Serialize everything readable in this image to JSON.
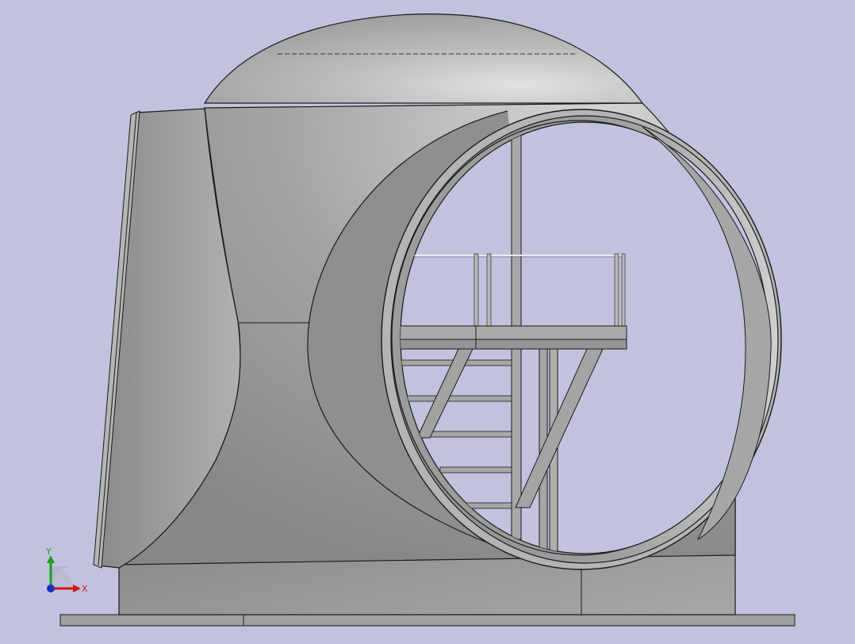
{
  "viewport": {
    "background": "#c1c3de",
    "model_fill": "#9a9a9a",
    "edge_color": "#1a1a1a"
  },
  "triad": {
    "x_label": "X",
    "y_label": "Y",
    "x_color": "#d01818",
    "y_color": "#18a018",
    "z_color": "#1830c8"
  }
}
